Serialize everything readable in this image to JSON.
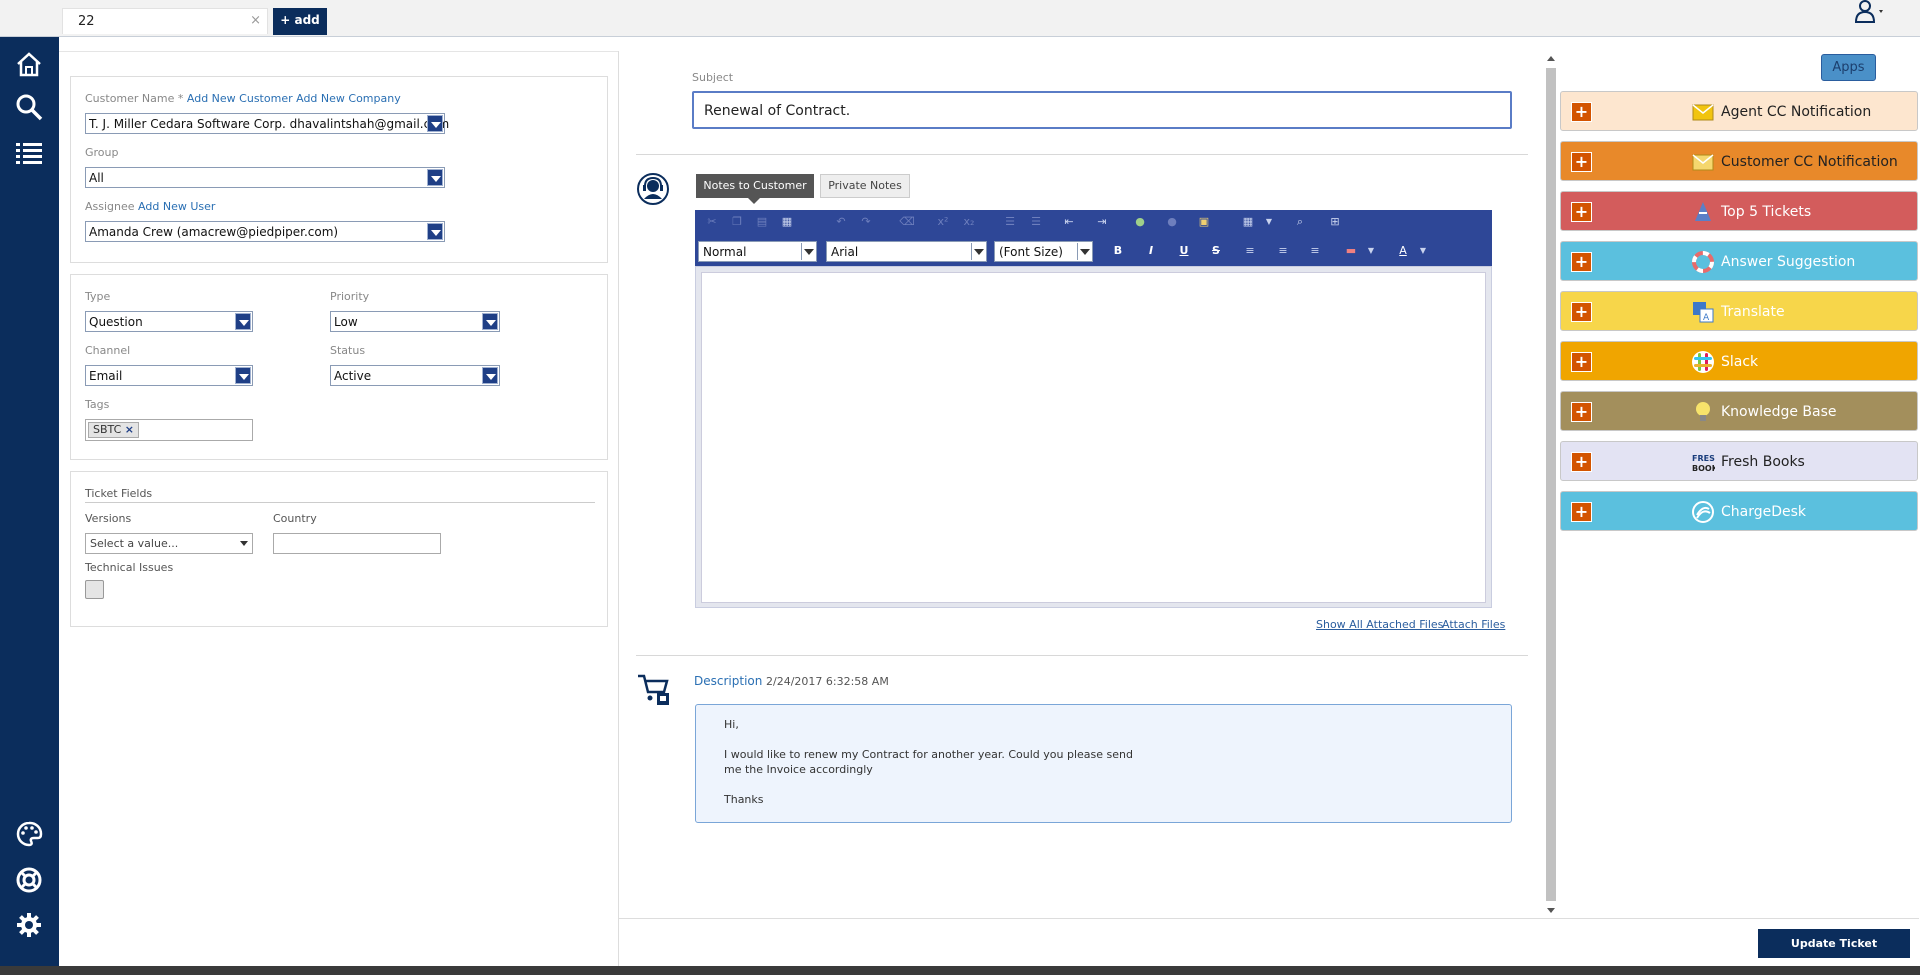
{
  "topbar": {
    "ticket_tab_value": "22",
    "close_glyph": "×",
    "add_label": "+ add"
  },
  "sidebar": {
    "items": [
      "home-icon",
      "search-icon",
      "list-icon",
      "palette-icon",
      "lifebuoy-icon",
      "gear-icon"
    ]
  },
  "customer_panel": {
    "customer_name_label": "Customer Name *",
    "add_customer_link": "Add New Customer",
    "add_company_link": "Add New Company",
    "customer_value": "T. J. Miller Cedara Software Corp. dhavalintshah@gmail.com",
    "group_label": "Group",
    "group_value": "All",
    "assignee_label": "Assignee",
    "add_user_link": "Add New User",
    "assignee_value": "Amanda Crew (amacrew@piedpiper.com)"
  },
  "properties_panel": {
    "type_label": "Type",
    "type_value": "Question",
    "priority_label": "Priority",
    "priority_value": "Low",
    "channel_label": "Channel",
    "channel_value": "Email",
    "status_label": "Status",
    "status_value": "Active",
    "tags_label": "Tags",
    "tags": [
      "SBTC"
    ],
    "tag_remove_glyph": "×"
  },
  "ticket_fields": {
    "title": "Ticket Fields",
    "versions_label": "Versions",
    "versions_placeholder": "Select a value...",
    "country_label": "Country",
    "country_value": "",
    "technical_issues_label": "Technical Issues"
  },
  "main": {
    "subject_label": "Subject",
    "subject_value": "Renewal of Contract.",
    "tabs": [
      "Notes to Customer",
      "Private Notes"
    ],
    "editor": {
      "format_value": "Normal",
      "font_value": "Arial",
      "size_value": "(Font Size)",
      "bold": "B",
      "italic": "I",
      "underline": "U",
      "strike": "S",
      "text_color": "A"
    },
    "show_all_files": "Show All Attached Files",
    "attach_files": "Attach Files",
    "description_title": "Description",
    "description_date": "2/24/2017 6:32:58 AM",
    "description_lines": [
      "Hi,",
      "I would like to renew my Contract for another year. Could you please send",
      "me the Invoice accordingly",
      "Thanks"
    ]
  },
  "apps_panel": {
    "apps_button": "Apps",
    "plus_glyph": "+",
    "apps": [
      {
        "label": "Agent CC Notification",
        "bg": "#fde6cf",
        "fg": "#222",
        "icon": "envelope-icon",
        "icon_color": "#f1c40f"
      },
      {
        "label": "Customer CC Notification",
        "bg": "#e8892a",
        "fg": "#222",
        "icon": "envelope-icon",
        "icon_color": "#f5d76e"
      },
      {
        "label": "Top 5 Tickets",
        "bg": "#d35c5c",
        "fg": "#fff",
        "icon": "cone-icon",
        "icon_color": "#5b7fc7"
      },
      {
        "label": "Answer Suggestion",
        "bg": "#5bc0de",
        "fg": "#fff",
        "icon": "lifering-icon",
        "icon_color": "#e86b6b"
      },
      {
        "label": "Translate",
        "bg": "#f7d64a",
        "fg": "#fff",
        "icon": "translate-icon",
        "icon_color": "#3d78c8"
      },
      {
        "label": "Slack",
        "bg": "#f0a500",
        "fg": "#fff",
        "icon": "slack-icon",
        "icon_color": "#7ac943"
      },
      {
        "label": "Knowledge Base",
        "bg": "#a38f5c",
        "fg": "#fff",
        "icon": "bulb-icon",
        "icon_color": "#f7e36b"
      },
      {
        "label": "Fresh Books",
        "bg": "#e3e3f3",
        "fg": "#222",
        "icon": "freshbooks-icon",
        "icon_color": "#1a3d7c"
      },
      {
        "label": "ChargeDesk",
        "bg": "#5bc0de",
        "fg": "#fff",
        "icon": "chargedesk-icon",
        "icon_color": "#ffffff"
      }
    ]
  },
  "footer": {
    "update_button": "Update Ticket"
  }
}
